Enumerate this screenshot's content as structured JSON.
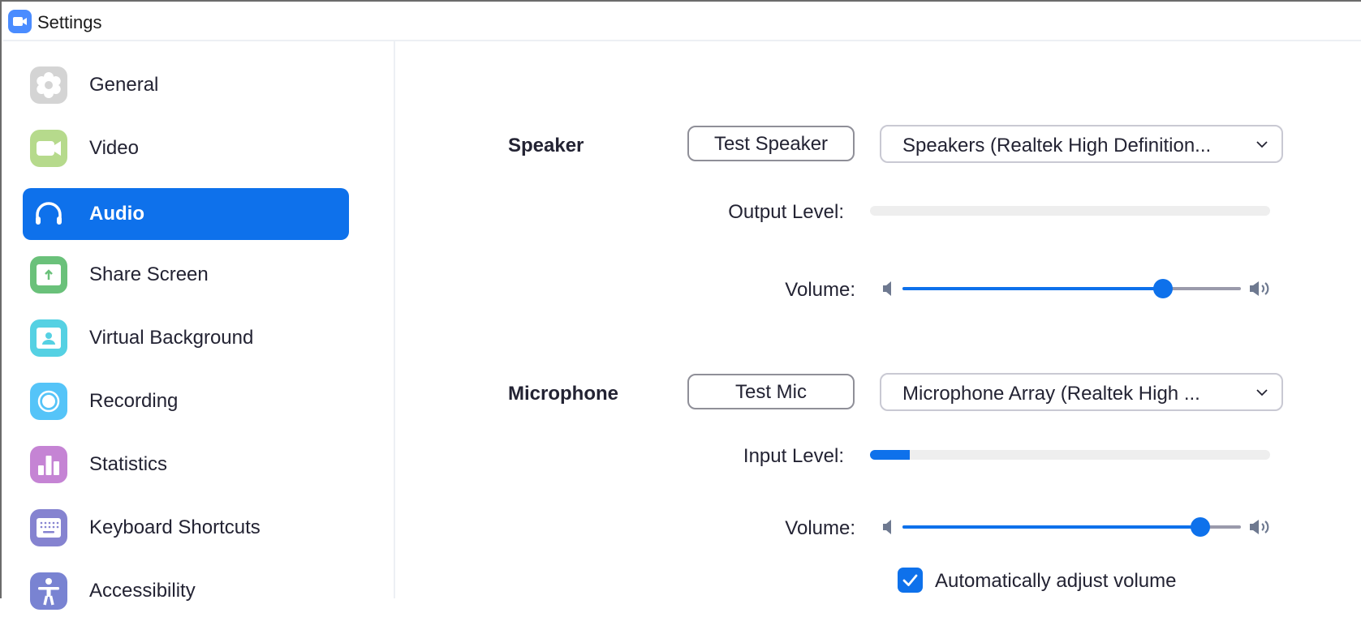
{
  "window": {
    "title": "Settings",
    "icon": "zoom-app-icon"
  },
  "colors": {
    "accent": "#0e71eb",
    "text": "#232333",
    "slider_rest": "#9a9aab",
    "level_bg": "#eeeeee"
  },
  "sidebar": {
    "active": "Audio",
    "items": [
      {
        "label": "General",
        "icon": "gear-icon",
        "color": "#d4d4d4"
      },
      {
        "label": "Video",
        "icon": "video-camera-icon",
        "color": "#b6da8c"
      },
      {
        "label": "Audio",
        "icon": "headphones-icon",
        "color": "#0e71eb"
      },
      {
        "label": "Share Screen",
        "icon": "share-screen-icon",
        "color": "#6ac17a"
      },
      {
        "label": "Virtual Background",
        "icon": "virtual-background-icon",
        "color": "#55d1e3"
      },
      {
        "label": "Recording",
        "icon": "recording-icon",
        "color": "#55c4f8"
      },
      {
        "label": "Statistics",
        "icon": "statistics-icon",
        "color": "#c584d4"
      },
      {
        "label": "Keyboard Shortcuts",
        "icon": "keyboard-icon",
        "color": "#8583d0"
      },
      {
        "label": "Accessibility",
        "icon": "accessibility-icon",
        "color": "#7983d2"
      }
    ]
  },
  "speaker": {
    "title": "Speaker",
    "test_button": "Test Speaker",
    "device": "Speakers (Realtek High Definition...",
    "output_level_label": "Output Level:",
    "output_level": 0,
    "volume_label": "Volume:",
    "volume": 0.77
  },
  "microphone": {
    "title": "Microphone",
    "test_button": "Test Mic",
    "device": "Microphone Array (Realtek High ...",
    "input_level_label": "Input Level:",
    "input_level": 0.1,
    "volume_label": "Volume:",
    "volume": 0.88,
    "auto_adjust_label": "Automatically adjust volume",
    "auto_adjust_checked": true
  }
}
